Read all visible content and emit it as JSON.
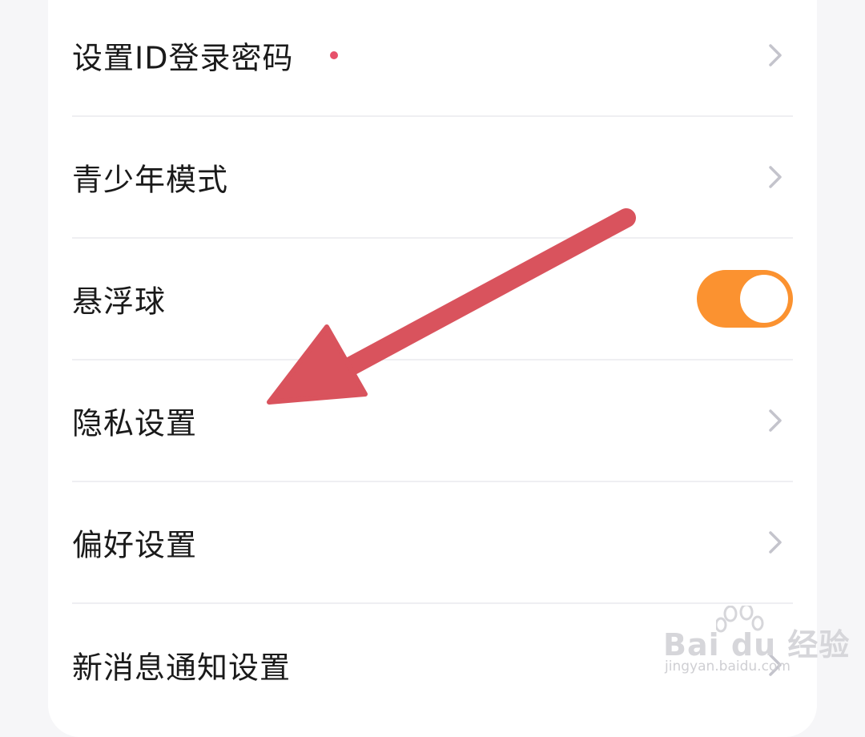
{
  "colors": {
    "accent_toggle": "#fb9230",
    "badge_dot": "#e7506a",
    "chevron": "#c4c4cc",
    "annotation_arrow": "#d9535d"
  },
  "settings": {
    "items": [
      {
        "label": "设置ID登录密码",
        "control": "chevron",
        "badge": true
      },
      {
        "label": "青少年模式",
        "control": "chevron"
      },
      {
        "label": "悬浮球",
        "control": "toggle",
        "toggle_on": true
      },
      {
        "label": "隐私设置",
        "control": "chevron"
      },
      {
        "label": "偏好设置",
        "control": "chevron"
      },
      {
        "label": "新消息通知设置",
        "control": "chevron"
      }
    ]
  },
  "watermark": {
    "brand": "Bai du 经验",
    "url": "jingyan.baidu.com"
  }
}
